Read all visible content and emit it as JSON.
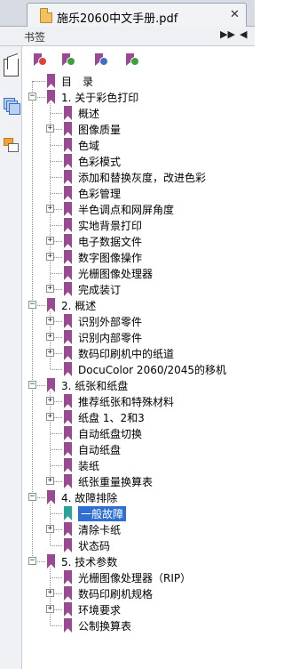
{
  "tab": {
    "title": "施乐2060中文手册.pdf",
    "close": "✕"
  },
  "panel": {
    "label": "书签",
    "expand_btn": "▶▶",
    "collapse_btn": "◀"
  },
  "sidebar": {
    "icons": [
      "pages-icon",
      "layers-icon",
      "comments-icon"
    ]
  },
  "toolbar": {
    "buttons": [
      "delete-bookmark-icon",
      "add-bookmark-icon",
      "move-bookmark-icon",
      "expand-bookmark-icon"
    ]
  },
  "tree": [
    {
      "label": "目　录",
      "level": 0,
      "toggle": ""
    },
    {
      "label": "1. 关于彩色打印",
      "level": 0,
      "toggle": "−"
    },
    {
      "label": "概述",
      "level": 1,
      "toggle": ""
    },
    {
      "label": "图像质量",
      "level": 1,
      "toggle": "+"
    },
    {
      "label": "色域",
      "level": 1,
      "toggle": ""
    },
    {
      "label": "色彩模式",
      "level": 1,
      "toggle": ""
    },
    {
      "label": "添加和替换灰度，改进色彩",
      "level": 1,
      "toggle": ""
    },
    {
      "label": "色彩管理",
      "level": 1,
      "toggle": ""
    },
    {
      "label": "半色调点和网屏角度",
      "level": 1,
      "toggle": "+"
    },
    {
      "label": "实地背景打印",
      "level": 1,
      "toggle": ""
    },
    {
      "label": "电子数据文件",
      "level": 1,
      "toggle": "+"
    },
    {
      "label": "数字图像操作",
      "level": 1,
      "toggle": "+"
    },
    {
      "label": "光栅图像处理器",
      "level": 1,
      "toggle": ""
    },
    {
      "label": "完成装订",
      "level": 1,
      "toggle": "+"
    },
    {
      "label": "2. 概述",
      "level": 0,
      "toggle": "−"
    },
    {
      "label": "识别外部零件",
      "level": 1,
      "toggle": "+"
    },
    {
      "label": "识别内部零件",
      "level": 1,
      "toggle": "+"
    },
    {
      "label": "数码印刷机中的纸道",
      "level": 1,
      "toggle": "+"
    },
    {
      "label": "DocuColor 2060/2045的移机",
      "level": 1,
      "toggle": ""
    },
    {
      "label": "3. 纸张和纸盘",
      "level": 0,
      "toggle": "−"
    },
    {
      "label": "推荐纸张和特殊材料",
      "level": 1,
      "toggle": "+"
    },
    {
      "label": "纸盘 1、2和3",
      "level": 1,
      "toggle": "+"
    },
    {
      "label": "自动纸盘切换",
      "level": 1,
      "toggle": ""
    },
    {
      "label": "自动纸盘",
      "level": 1,
      "toggle": ""
    },
    {
      "label": "装纸",
      "level": 1,
      "toggle": ""
    },
    {
      "label": "纸张重量换算表",
      "level": 1,
      "toggle": "+"
    },
    {
      "label": "4. 故障排除",
      "level": 0,
      "toggle": "−"
    },
    {
      "label": "一般故障",
      "level": 1,
      "toggle": "",
      "selected": true
    },
    {
      "label": "清除卡纸",
      "level": 1,
      "toggle": "+"
    },
    {
      "label": "状态码",
      "level": 1,
      "toggle": ""
    },
    {
      "label": "5. 技术参数",
      "level": 0,
      "toggle": "−"
    },
    {
      "label": "光栅图像处理器（RIP）",
      "level": 1,
      "toggle": ""
    },
    {
      "label": "数码印刷机规格",
      "level": 1,
      "toggle": "+"
    },
    {
      "label": "环境要求",
      "level": 1,
      "toggle": "+"
    },
    {
      "label": "公制换算表",
      "level": 1,
      "toggle": ""
    }
  ]
}
